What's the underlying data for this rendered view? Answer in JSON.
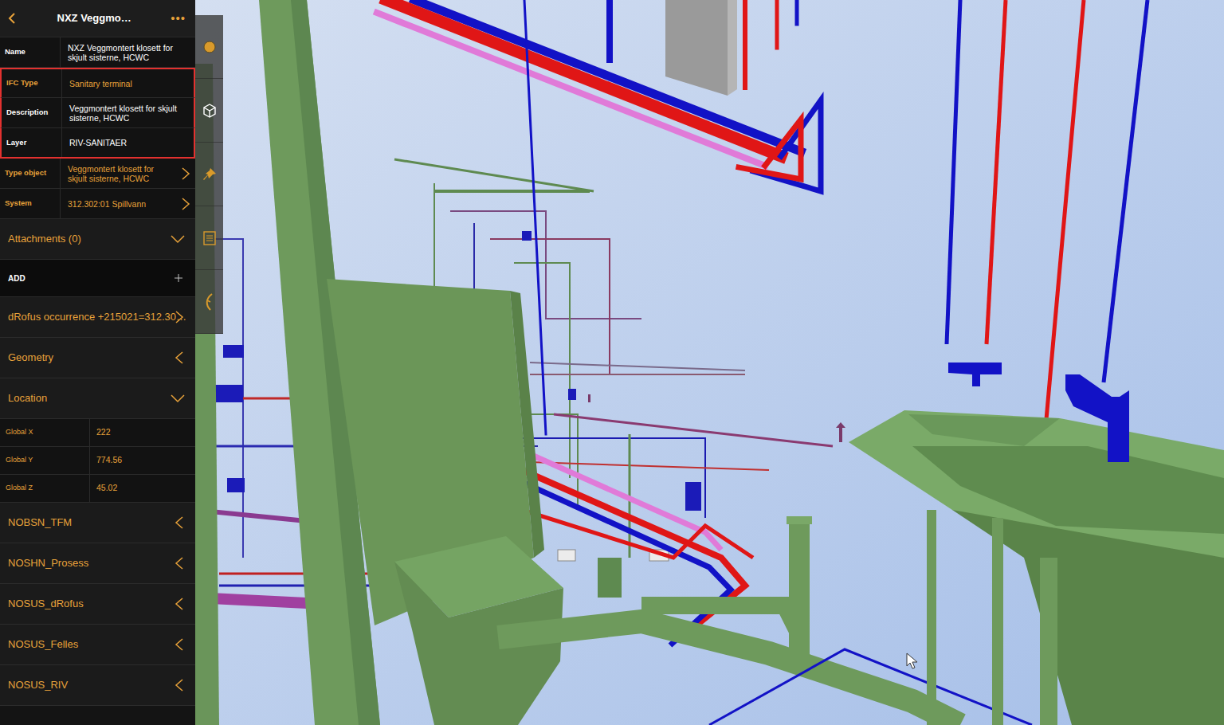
{
  "header": {
    "title": "NXZ Veggmo…",
    "menu": "•••"
  },
  "properties": [
    {
      "label": "Name",
      "value": "NXZ Veggmontert klosett for skjult sisterne, HCWC",
      "kind": "plain",
      "highlighted": false,
      "link": false
    },
    {
      "label": "IFC Type",
      "value": "Sanitary terminal",
      "kind": "accent",
      "highlighted": true,
      "link": false
    },
    {
      "label": "Description",
      "value": "Veggmontert klosett for skjult sisterne, HCWC",
      "kind": "plain",
      "highlighted": true,
      "link": false
    },
    {
      "label": "Layer",
      "value": "RIV-SANITAER",
      "kind": "plain",
      "highlighted": true,
      "link": false
    },
    {
      "label": "Type object",
      "value": "Veggmontert klosett for skjult sisterne, HCWC",
      "kind": "accent",
      "highlighted": false,
      "link": true
    },
    {
      "label": "System",
      "value": "312.302:01 Spillvann",
      "kind": "accent",
      "highlighted": false,
      "link": true
    }
  ],
  "sections": [
    {
      "label": "Attachments (0)",
      "kind": "toggle",
      "expanded": true,
      "fields": []
    },
    {
      "label": "ADD",
      "kind": "action",
      "expanded": false,
      "fields": []
    },
    {
      "label": "dRofus occurrence +215021=312.30…",
      "kind": "link",
      "expanded": false,
      "fields": []
    },
    {
      "label": "Geometry",
      "kind": "toggle",
      "expanded": false,
      "fields": []
    },
    {
      "label": "Location",
      "kind": "toggle",
      "expanded": true,
      "fields": [
        {
          "label": "Global X",
          "value": "222"
        },
        {
          "label": "Global Y",
          "value": "774.56"
        },
        {
          "label": "Global Z",
          "value": "45.02"
        }
      ]
    },
    {
      "label": "NOBSN_TFM",
      "kind": "toggle",
      "expanded": false,
      "fields": []
    },
    {
      "label": "NOSHN_Prosess",
      "kind": "toggle",
      "expanded": false,
      "fields": []
    },
    {
      "label": "NOSUS_dRofus",
      "kind": "toggle",
      "expanded": false,
      "fields": []
    },
    {
      "label": "NOSUS_Felles",
      "kind": "toggle",
      "expanded": false,
      "fields": []
    },
    {
      "label": "NOSUS_RIV",
      "kind": "toggle",
      "expanded": false,
      "fields": []
    }
  ],
  "toolbar": [
    {
      "selected": false
    },
    {
      "selected": true
    },
    {
      "selected": false
    },
    {
      "selected": false
    },
    {
      "selected": false
    }
  ]
}
